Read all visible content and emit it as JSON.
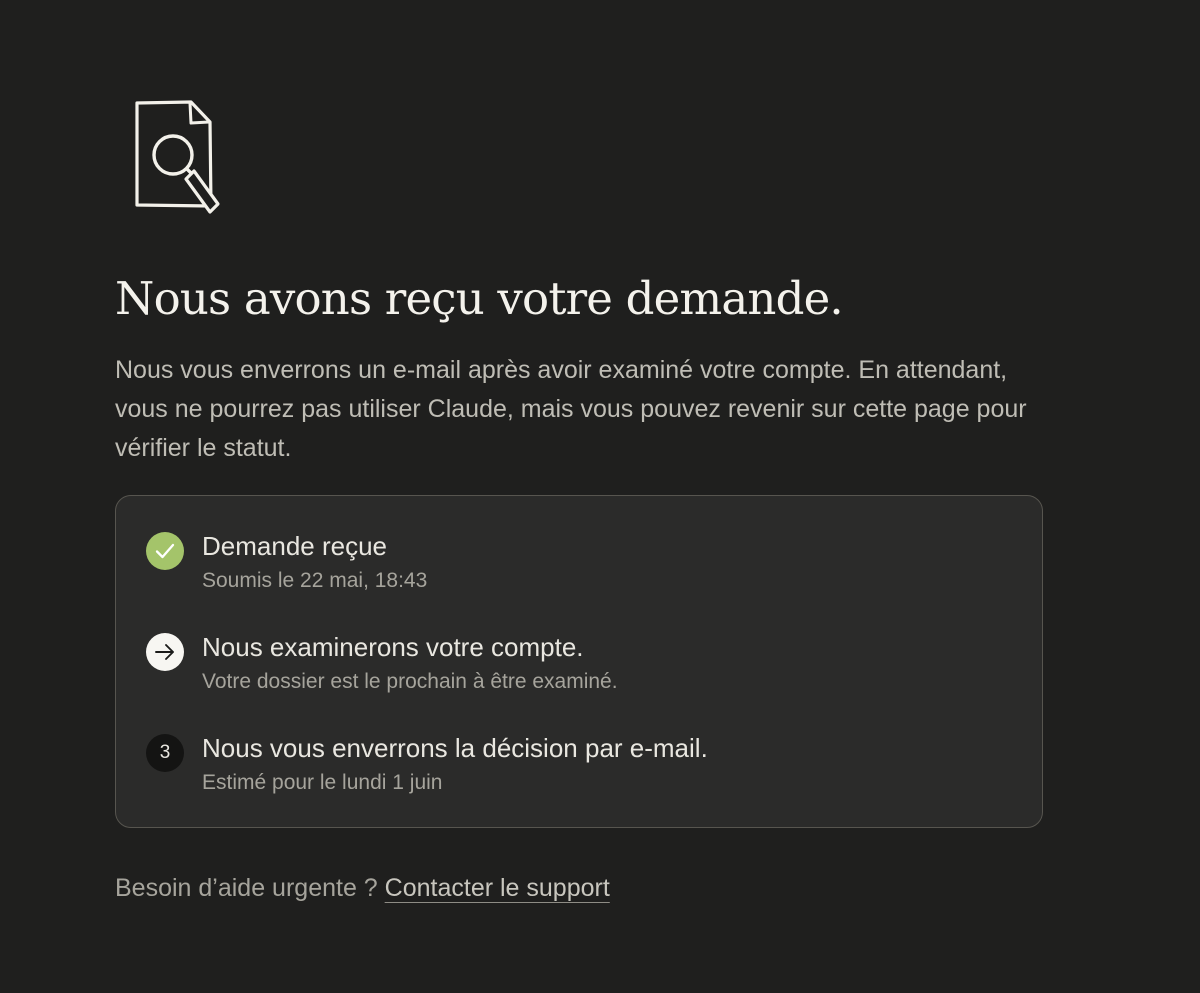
{
  "hero": {
    "icon": "document-search-icon",
    "title": "Nous avons reçu votre demande."
  },
  "intro": {
    "text": "Nous vous enverrons un e-mail après avoir examiné votre compte. En attendant, vous ne pourrez pas utiliser Claude, mais vous pouvez revenir sur cette page pour vérifier le statut."
  },
  "steps": [
    {
      "state": "done",
      "icon": "check-icon",
      "title": "Demande reçue",
      "subtitle": "Soumis le 22 mai, 18:43"
    },
    {
      "state": "current",
      "icon": "arrow-right-icon",
      "title": "Nous examinerons votre compte.",
      "subtitle": "Votre dossier est le prochain à être examiné."
    },
    {
      "state": "pending",
      "number": "3",
      "title": "Nous vous enverrons la décision par e-mail.",
      "subtitle": "Estimé pour le lundi 1 juin"
    }
  ],
  "help": {
    "question": "Besoin d’aide urgente ? ",
    "link_label": "Contacter le support"
  },
  "colors": {
    "background": "#1f1f1e",
    "card": "#2b2b2a",
    "success": "#a4c46a"
  }
}
